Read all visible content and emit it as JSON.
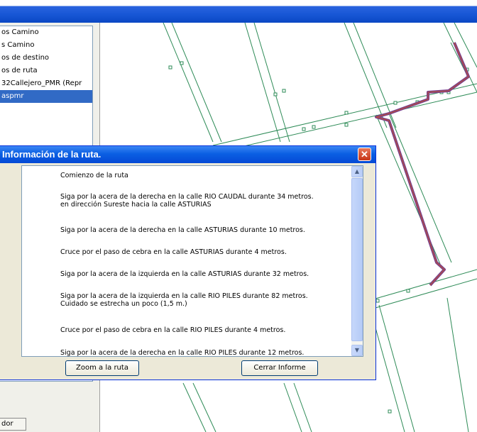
{
  "layers": {
    "items": [
      {
        "label": "os Camino",
        "selected": false
      },
      {
        "label": "s Camino",
        "selected": false
      },
      {
        "label": "os de destino",
        "selected": false
      },
      {
        "label": "os de ruta",
        "selected": false
      },
      {
        "label": "32Callejero_PMR (Repr",
        "selected": false
      },
      {
        "label": "aspmr",
        "selected": true
      }
    ],
    "bottom_tab": "dor"
  },
  "dialog": {
    "title": "Información de la ruta.",
    "close_glyph": "✕",
    "instructions": [
      "Comienzo de la ruta",
      "Siga por la acera de la derecha en la calle RIO CAUDAL durante 34 metros.\nen dirección Sureste hacia la calle ASTURIAS",
      "Siga por la acera de la derecha en la calle ASTURIAS durante 10 metros.",
      "Cruce por el paso de cebra en la calle ASTURIAS durante 4 metros.",
      "Siga por la acera de la izquierda en la calle ASTURIAS durante 32 metros.",
      "Siga por la acera de la izquierda en la calle RIO PILES durante 82 metros.\nCuidado se estrecha un poco (1,5 m.)",
      "Cruce por el paso de cebra en la calle RIO PILES durante 4 metros.",
      "Siga por la acera de la derecha en la calle RIO PILES durante 12 metros."
    ],
    "zoom_button": "Zoom a la ruta",
    "close_button": "Cerrar Informe"
  },
  "colors": {
    "street_line": "#2e8b57",
    "route_line": "#7b3f8c",
    "title_bar": "#0b5fe3"
  },
  "icons": {
    "close": "close-icon",
    "scroll_up": "chevron-up-icon",
    "scroll_down": "chevron-down-icon"
  }
}
